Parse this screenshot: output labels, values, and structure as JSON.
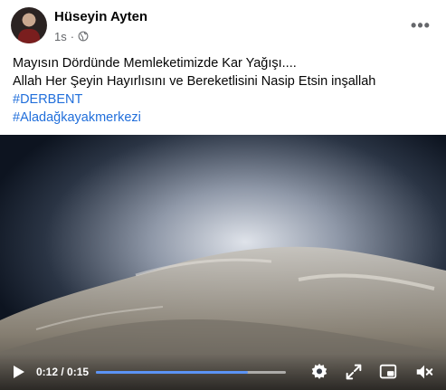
{
  "post": {
    "author": "Hüseyin Ayten",
    "timestamp": "1s",
    "separator": "·",
    "privacy_icon": "globe-icon",
    "more_icon": "more-options-icon",
    "more_label": "•••",
    "text_lines": [
      "Mayısın Dördünde Memleketimizde Kar Yağışı....",
      "Allah Her Şeyin Hayırlısını ve Bereketlisini Nasip Etsin inşallah"
    ],
    "hashtags": [
      "#DERBENT",
      "#Aladağkayakmerkezi"
    ]
  },
  "video": {
    "time_display": "0:12 / 0:15",
    "progress": 0.8,
    "controls": [
      "play-icon",
      "settings-icon",
      "fullscreen-icon",
      "picture-in-picture-icon",
      "mute-icon"
    ],
    "colors": {
      "progress_fill": "#5b93f5",
      "hashtag": "#216fdb"
    }
  }
}
